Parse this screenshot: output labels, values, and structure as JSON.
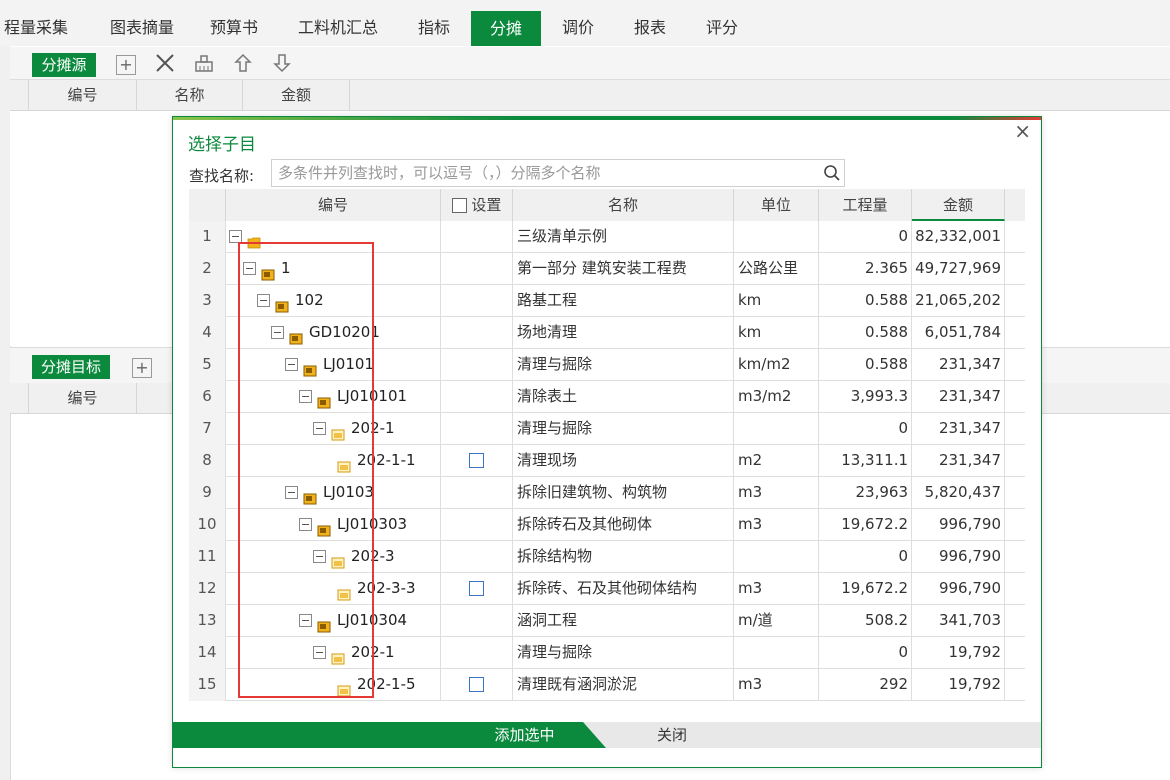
{
  "tabs": [
    "程量采集",
    "图表摘量",
    "预算书",
    "工料机汇总",
    "指标",
    "分摊",
    "调价",
    "报表",
    "评分"
  ],
  "active_tab": "分摊",
  "source_panel": {
    "title": "分摊源",
    "columns": [
      "编号",
      "名称",
      "金额"
    ]
  },
  "target_panel": {
    "title": "分摊目标",
    "columns": [
      "编号"
    ]
  },
  "dialog": {
    "title": "选择子目",
    "search_label": "查找名称:",
    "search_placeholder": "多条件并列查找时，可以逗号（，）分隔多个名称",
    "columns": {
      "code": "编号",
      "set": "设置",
      "name": "名称",
      "unit": "单位",
      "qty": "工程量",
      "amount": "金额"
    },
    "rows": [
      {
        "no": "1",
        "code": "",
        "name": "三级清单示例",
        "unit": "",
        "qty": "0",
        "amount": "82,332,001",
        "level": 0,
        "icon": "folder-icon",
        "check": false
      },
      {
        "no": "2",
        "code": "1",
        "name": "第一部分 建筑安装工程费",
        "unit": "公路公里",
        "qty": "2.365",
        "amount": "49,727,969",
        "level": 1,
        "icon": "item-icon",
        "check": false
      },
      {
        "no": "3",
        "code": "102",
        "name": "路基工程",
        "unit": "km",
        "qty": "0.588",
        "amount": "21,065,202",
        "level": 2,
        "icon": "item-icon",
        "check": false
      },
      {
        "no": "4",
        "code": "GD10201",
        "name": "场地清理",
        "unit": "km",
        "qty": "0.588",
        "amount": "6,051,784",
        "level": 3,
        "icon": "item-icon",
        "check": false
      },
      {
        "no": "5",
        "code": "LJ0101",
        "name": "清理与掘除",
        "unit": "km/m2",
        "qty": "0.588",
        "amount": "231,347",
        "level": 4,
        "icon": "item-icon",
        "check": false
      },
      {
        "no": "6",
        "code": "LJ010101",
        "name": "清除表土",
        "unit": "m3/m2",
        "qty": "3,993.3",
        "amount": "231,347",
        "level": 5,
        "icon": "item-icon",
        "check": false
      },
      {
        "no": "7",
        "code": "202-1",
        "name": "清理与掘除",
        "unit": "",
        "qty": "0",
        "amount": "231,347",
        "level": 6,
        "icon": "list-icon",
        "check": false
      },
      {
        "no": "8",
        "code": "202-1-1",
        "name": "清理现场",
        "unit": "m2",
        "qty": "13,311.1",
        "amount": "231,347",
        "level": 7,
        "icon": "list-icon",
        "check": true
      },
      {
        "no": "9",
        "code": "LJ0103",
        "name": "拆除旧建筑物、构筑物",
        "unit": "m3",
        "qty": "23,963",
        "amount": "5,820,437",
        "level": 4,
        "icon": "item-icon",
        "check": false
      },
      {
        "no": "10",
        "code": "LJ010303",
        "name": "拆除砖石及其他砌体",
        "unit": "m3",
        "qty": "19,672.2",
        "amount": "996,790",
        "level": 5,
        "icon": "item-icon",
        "check": false
      },
      {
        "no": "11",
        "code": "202-3",
        "name": "拆除结构物",
        "unit": "",
        "qty": "0",
        "amount": "996,790",
        "level": 6,
        "icon": "list-icon",
        "check": false
      },
      {
        "no": "12",
        "code": "202-3-3",
        "name": "拆除砖、石及其他砌体结构",
        "unit": "m3",
        "qty": "19,672.2",
        "amount": "996,790",
        "level": 7,
        "icon": "list-icon",
        "check": true
      },
      {
        "no": "13",
        "code": "LJ010304",
        "name": "涵洞工程",
        "unit": "m/道",
        "qty": "508.2",
        "amount": "341,703",
        "level": 5,
        "icon": "item-icon",
        "check": false
      },
      {
        "no": "14",
        "code": "202-1",
        "name": "清理与掘除",
        "unit": "",
        "qty": "0",
        "amount": "19,792",
        "level": 6,
        "icon": "list-icon",
        "check": false
      },
      {
        "no": "15",
        "code": "202-1-5",
        "name": "清理既有涵洞淤泥",
        "unit": "m3",
        "qty": "292",
        "amount": "19,792",
        "level": 7,
        "icon": "list-icon",
        "check": true
      }
    ],
    "add_button": "添加选中",
    "close_button": "关闭"
  },
  "colors": {
    "accent": "#0b8a3e",
    "highlight_border": "#e53935"
  }
}
